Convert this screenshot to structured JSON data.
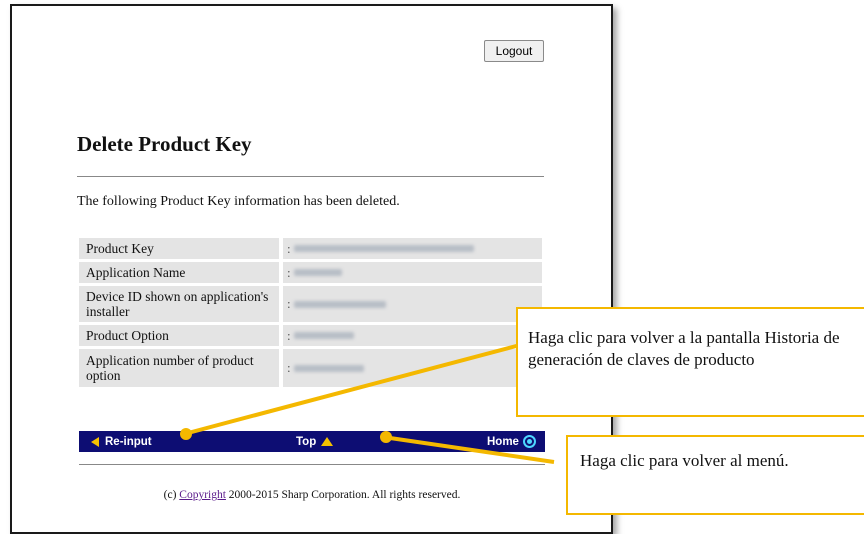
{
  "page": {
    "logout_label": "Logout",
    "title": "Delete Product Key",
    "message": "The following Product Key information has been deleted."
  },
  "info_rows": [
    {
      "label": "Product Key",
      "value": ":"
    },
    {
      "label": "Application Name",
      "value": ":"
    },
    {
      "label": "Device ID shown on application's installer",
      "value": ":"
    },
    {
      "label": "Product Option",
      "value": ":"
    },
    {
      "label": "Application number of product option",
      "value": ":"
    }
  ],
  "navbar": {
    "reinput": "Re-input",
    "top": "Top",
    "home": "Home"
  },
  "footer": {
    "prefix": "(c)",
    "link": "Copyright",
    "suffix": "2000-2015 Sharp Corporation. All rights reserved."
  },
  "callouts": {
    "reinput": "Haga clic para volver a la pantalla Historia de generación de claves de producto",
    "top": "Haga clic para volver al menú."
  },
  "colors": {
    "navbar": "#0d0d73",
    "callout_border": "#f4b800",
    "arrow": "#f5c200"
  }
}
